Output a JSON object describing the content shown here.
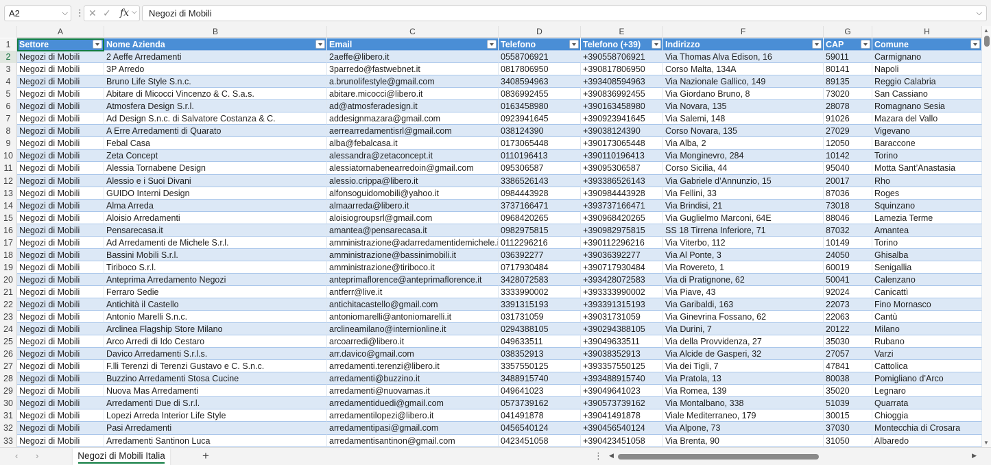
{
  "formula_bar": {
    "name_box": "A2",
    "formula": "Negozi di Mobili",
    "fx_label": "fx"
  },
  "columns": [
    "A",
    "B",
    "C",
    "D",
    "E",
    "F",
    "G",
    "H"
  ],
  "header_row": [
    "Settore",
    "Nome Azienda",
    "Email",
    "Telefono",
    "Telefono (+39)",
    "Indirizzo",
    "CAP",
    "Comune"
  ],
  "rows": [
    [
      "Negozi di Mobili",
      "2 Aeffe Arredamenti",
      "2aeffe@libero.it",
      "0558706921",
      "+390558706921",
      "Via Thomas Alva Edison, 16",
      "59011",
      "Carmignano"
    ],
    [
      "Negozi di Mobili",
      "3P Arredo",
      "3parredo@fastwebnet.it",
      "0817806950",
      "+390817806950",
      "Corso Malta, 134A",
      "80141",
      "Napoli"
    ],
    [
      "Negozi di Mobili",
      "Bruno Life Style S.n.c.",
      "a.brunolifestyle@gmail.com",
      "3408594963",
      "+393408594963",
      "Via Nazionale Gallico, 149",
      "89135",
      "Reggio Calabria"
    ],
    [
      "Negozi di Mobili",
      "Abitare di Micocci Vincenzo & C. S.a.s.",
      "abitare.micocci@libero.it",
      "0836992455",
      "+390836992455",
      "Via Giordano Bruno, 8",
      "73020",
      "San Cassiano"
    ],
    [
      "Negozi di Mobili",
      "Atmosfera Design S.r.l.",
      "ad@atmosferadesign.it",
      "0163458980",
      "+390163458980",
      "Via Novara, 135",
      "28078",
      "Romagnano Sesia"
    ],
    [
      "Negozi di Mobili",
      "Ad Design S.n.c. di Salvatore Costanza & C.",
      "addesignmazara@gmail.com",
      "0923941645",
      "+390923941645",
      "Via Salemi, 148",
      "91026",
      "Mazara del Vallo"
    ],
    [
      "Negozi di Mobili",
      "A Erre Arredamenti di Quarato",
      "aerrearredamentisrl@gmail.com",
      "038124390",
      "+39038124390",
      "Corso Novara, 135",
      "27029",
      "Vigevano"
    ],
    [
      "Negozi di Mobili",
      "Febal Casa",
      "alba@febalcasa.it",
      "0173065448",
      "+390173065448",
      "Via Alba, 2",
      "12050",
      "Baraccone"
    ],
    [
      "Negozi di Mobili",
      "Zeta Concept",
      "alessandra@zetaconcept.it",
      "0110196413",
      "+390110196413",
      "Via Monginevro, 284",
      "10142",
      "Torino"
    ],
    [
      "Negozi di Mobili",
      "Alessia Tornabene Design",
      "alessiatornabenearredoin@gmail.com",
      "095306587",
      "+39095306587",
      "Corso Sicilia, 44",
      "95040",
      "Motta Sant’Anastasia"
    ],
    [
      "Negozi di Mobili",
      "Alessio e i Suoi Divani",
      "alessio.crippa@libero.it",
      "3386526143",
      "+393386526143",
      "Via Gabriele d’Annunzio, 15",
      "20017",
      "Rho"
    ],
    [
      "Negozi di Mobili",
      "GUIDO Interni Design",
      "alfonsoguidomobili@yahoo.it",
      "0984443928",
      "+390984443928",
      "Via Fellini, 33",
      "87036",
      "Roges"
    ],
    [
      "Negozi di Mobili",
      "Alma Arreda",
      "almaarreda@libero.it",
      "3737166471",
      "+393737166471",
      "Via Brindisi, 21",
      "73018",
      "Squinzano"
    ],
    [
      "Negozi di Mobili",
      "Aloisio Arredamenti",
      "aloisiogroupsrl@gmail.com",
      "0968420265",
      "+390968420265",
      "Via Guglielmo Marconi, 64E",
      "88046",
      "Lamezia Terme"
    ],
    [
      "Negozi di Mobili",
      "Pensarecasa.it",
      "amantea@pensarecasa.it",
      "0982975815",
      "+390982975815",
      "SS 18 Tirrena Inferiore, 71",
      "87032",
      "Amantea"
    ],
    [
      "Negozi di Mobili",
      "Ad Arredamenti de Michele S.r.l.",
      "amministrazione@adarredamentidemichele.i",
      "0112296216",
      "+390112296216",
      "Via Viterbo, 112",
      "10149",
      "Torino"
    ],
    [
      "Negozi di Mobili",
      "Bassini Mobili S.r.l.",
      "amministrazione@bassinimobili.it",
      "036392277",
      "+39036392277",
      "Via Al Ponte, 3",
      "24050",
      "Ghisalba"
    ],
    [
      "Negozi di Mobili",
      "Tiriboco S.r.l.",
      "amministrazione@tiriboco.it",
      "0717930484",
      "+390717930484",
      "Via Rovereto, 1",
      "60019",
      "Senigallia"
    ],
    [
      "Negozi di Mobili",
      "Anteprima Arredamento Negozi",
      "anteprimaflorence@anteprimaflorence.it",
      "3428072583",
      "+393428072583",
      "Via di Pratignone, 62",
      "50041",
      "Calenzano"
    ],
    [
      "Negozi di Mobili",
      "Ferraro Sedie",
      "antferr@live.it",
      "3333990002",
      "+393333990002",
      "Via Piave, 43",
      "92024",
      "Canicattì"
    ],
    [
      "Negozi di Mobili",
      "Antichità il Castello",
      "antichitacastello@gmail.com",
      "3391315193",
      "+393391315193",
      "Via Garibaldi, 163",
      "22073",
      "Fino Mornasco"
    ],
    [
      "Negozi di Mobili",
      "Antonio Marelli S.n.c.",
      "antoniomarelli@antoniomarelli.it",
      "031731059",
      "+39031731059",
      "Via Ginevrina Fossano, 62",
      "22063",
      "Cantù"
    ],
    [
      "Negozi di Mobili",
      "Arclinea Flagship Store Milano",
      "arclineamilano@internionline.it",
      "0294388105",
      "+390294388105",
      "Via Durini, 7",
      "20122",
      "Milano"
    ],
    [
      "Negozi di Mobili",
      "Arco Arredi di Ido Cestaro",
      "arcoarredi@libero.it",
      "049633511",
      "+39049633511",
      "Via della Provvidenza, 27",
      "35030",
      "Rubano"
    ],
    [
      "Negozi di Mobili",
      "Davico Arredamenti S.r.l.s.",
      "arr.davico@gmail.com",
      "038352913",
      "+39038352913",
      "Via Alcide de Gasperi, 32",
      "27057",
      "Varzi"
    ],
    [
      "Negozi di Mobili",
      "F.lli Terenzi di Terenzi Gustavo e C. S.n.c.",
      "arredamenti.terenzi@libero.it",
      "3357550125",
      "+393357550125",
      "Via dei Tigli, 7",
      "47841",
      "Cattolica"
    ],
    [
      "Negozi di Mobili",
      "Buzzino Arredamenti Stosa Cucine",
      "arredamenti@buzzino.it",
      "3488915740",
      "+393488915740",
      "Via Pratola, 13",
      "80038",
      "Pomigliano d’Arco"
    ],
    [
      "Negozi di Mobili",
      "Nuova Mas Arredamenti",
      "arredamenti@nuovamas.it",
      "049641023",
      "+39049641023",
      "Via Romea, 139",
      "35020",
      "Legnaro"
    ],
    [
      "Negozi di Mobili",
      "Arredamenti Due di S.r.l.",
      "arredamentiduedi@gmail.com",
      "0573739162",
      "+390573739162",
      "Via Montalbano, 338",
      "51039",
      "Quarrata"
    ],
    [
      "Negozi di Mobili",
      "Lopezi Arreda Interior Life Style",
      "arredamentilopezi@libero.it",
      "041491878",
      "+39041491878",
      "Viale Mediterraneo, 179",
      "30015",
      "Chioggia"
    ],
    [
      "Negozi di Mobili",
      "Pasi Arredamenti",
      "arredamentipasi@gmail.com",
      "0456540124",
      "+390456540124",
      "Via Alpone, 73",
      "37030",
      "Montecchia di Crosara"
    ],
    [
      "Negozi di Mobili",
      "Arredamenti Santinon Luca",
      "arredamentisantinon@gmail.com",
      "0423451058",
      "+390423451058",
      "Via Brenta, 90",
      "31050",
      "Albaredo"
    ]
  ],
  "sheet_tab": "Negozi di Mobili Italia",
  "add_sheet_glyph": "+",
  "colors": {
    "header_fill": "#4a8ed6",
    "band_fill": "#dce8f6",
    "accent": "#107c41"
  }
}
